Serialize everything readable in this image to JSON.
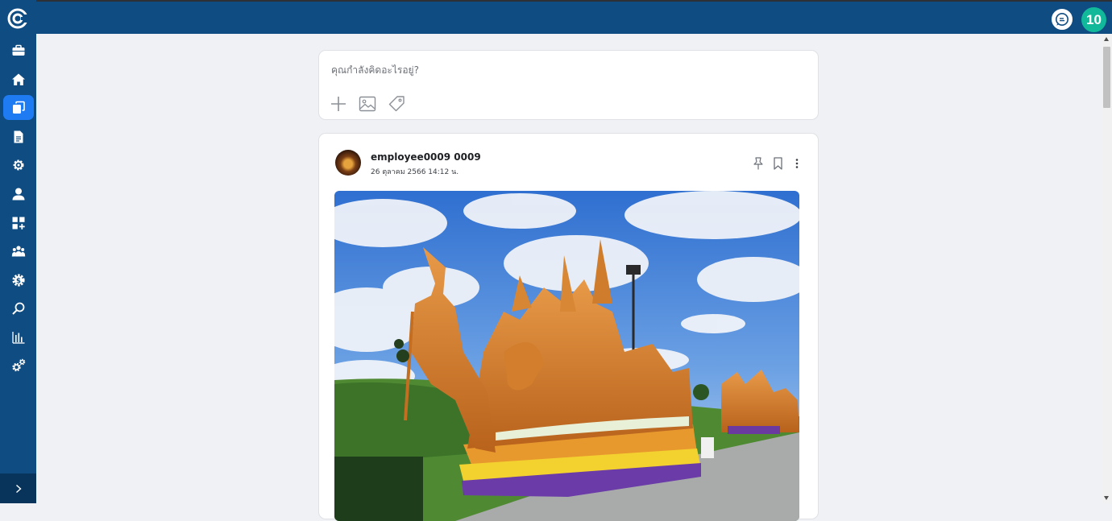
{
  "app": {
    "brand_color": "#0f4c81",
    "active_color": "#1f7bf2",
    "logo_icon": "c-logo-icon"
  },
  "sidebar": {
    "items": [
      {
        "name": "briefcase-icon",
        "active": false
      },
      {
        "name": "home-icon",
        "active": false
      },
      {
        "name": "copy-icon",
        "active": true
      },
      {
        "name": "document-icon",
        "active": false
      },
      {
        "name": "gear-icon",
        "active": false
      },
      {
        "name": "user-icon",
        "active": false
      },
      {
        "name": "apps-add-icon",
        "active": false
      },
      {
        "name": "team-icon",
        "active": false
      },
      {
        "name": "money-settings-icon",
        "active": false
      },
      {
        "name": "search-icon",
        "active": false
      },
      {
        "name": "bar-chart-icon",
        "active": false
      },
      {
        "name": "gears-icon",
        "active": false
      }
    ],
    "expand_icon": "chevron-right-icon"
  },
  "header": {
    "chat_icon": "chat-bubble-icon",
    "badge_count": "10",
    "badge_color": "#12b89a"
  },
  "composer": {
    "placeholder": "คุณกำลังคิดอะไรอยู่?",
    "tools": [
      "plus-icon",
      "image-icon",
      "tag-icon"
    ]
  },
  "post": {
    "author": "employee0009 0009",
    "date": "26 ตุลาคม 2566 14:12 น.",
    "actions": [
      "pin-icon",
      "bookmark-icon",
      "more-vertical-icon"
    ],
    "image_alt": "candle-festival-float-photo"
  }
}
